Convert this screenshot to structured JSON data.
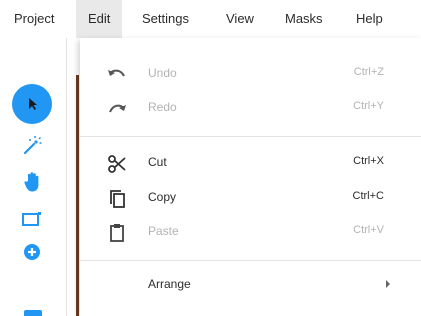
{
  "menubar": {
    "items": [
      {
        "label": "Project"
      },
      {
        "label": "Edit"
      },
      {
        "label": "Settings"
      },
      {
        "label": "View"
      },
      {
        "label": "Masks"
      },
      {
        "label": "Help"
      }
    ],
    "active": "Edit"
  },
  "toolbar": {
    "tools": [
      {
        "icon": "pointer-icon",
        "selected": true
      },
      {
        "icon": "magic-wand-icon"
      },
      {
        "icon": "hand-icon"
      },
      {
        "icon": "bounding-box-icon"
      },
      {
        "icon": "add-circle-icon"
      }
    ],
    "accent": "#2196f3"
  },
  "edit_menu": {
    "items": [
      {
        "label": "Undo",
        "shortcut": "Ctrl+Z",
        "icon": "undo-icon",
        "disabled": true
      },
      {
        "label": "Redo",
        "shortcut": "Ctrl+Y",
        "icon": "redo-icon",
        "disabled": true
      },
      {
        "label": "Cut",
        "shortcut": "Ctrl+X",
        "icon": "scissors-icon",
        "disabled": false
      },
      {
        "label": "Copy",
        "shortcut": "Ctrl+C",
        "icon": "copy-icon",
        "disabled": false
      },
      {
        "label": "Paste",
        "shortcut": "Ctrl+V",
        "icon": "clipboard-icon",
        "disabled": true
      },
      {
        "label": "Arrange",
        "icon": "submenu-arrow-icon",
        "disabled": false
      }
    ]
  }
}
